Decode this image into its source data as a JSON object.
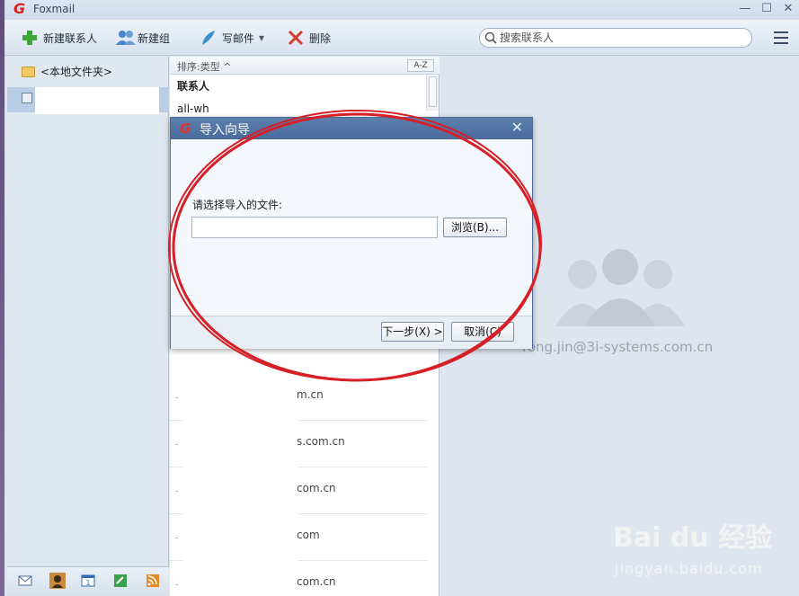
{
  "app": {
    "title": "Foxmail"
  },
  "window_controls": {
    "minimize": "—",
    "maximize": "☐",
    "close": "✕"
  },
  "toolbar": {
    "new_contact": "新建联系人",
    "new_group": "新建组",
    "compose": "写邮件",
    "compose_arrow": "▾",
    "delete": "删除",
    "search_placeholder": "搜索联系人"
  },
  "sidebar": {
    "local_folder": "<本地文件夹>"
  },
  "list": {
    "sort_label": "排序:类型 ^",
    "az_label": "A-Z",
    "group_header": "联系人",
    "first_item": "all-wh",
    "rows": [
      {
        "email": "m.cn"
      },
      {
        "email": "s.com.cn"
      },
      {
        "email": "com.cn"
      },
      {
        "email": "com"
      },
      {
        "email": "com.cn"
      }
    ]
  },
  "detail": {
    "email": "rong.jin@3i-systems.com.cn"
  },
  "dialog": {
    "title": "导入向导",
    "close": "✕",
    "prompt": "请选择导入的文件:",
    "file_value": "",
    "browse_label": "浏览(B)...",
    "next_label": "下一步(X) >",
    "cancel_label": "取消(C)"
  },
  "watermark": {
    "brand": "Bai  du 经验",
    "url": "jingyan.baidu.com"
  },
  "colors": {
    "annotation_red": "#d61f26",
    "dialog_title": "#4f72a3",
    "window_bg": "#dfe5ee"
  }
}
